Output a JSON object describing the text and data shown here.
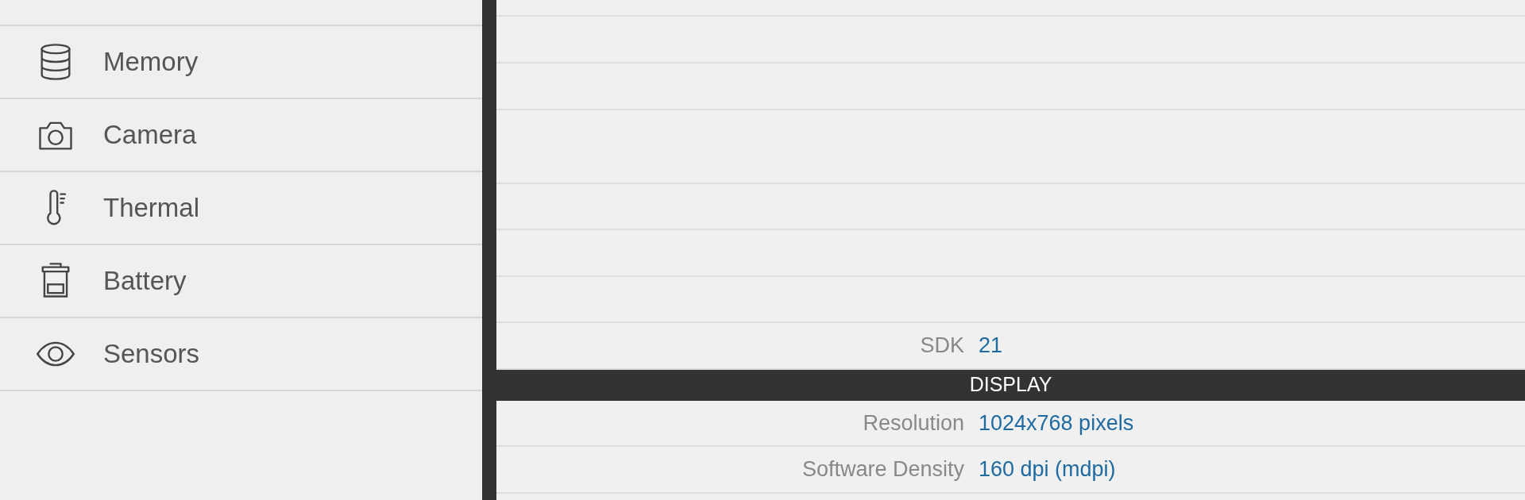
{
  "sidebar": {
    "items": [
      {
        "label": "Memory"
      },
      {
        "label": "Camera"
      },
      {
        "label": "Thermal"
      },
      {
        "label": "Battery"
      },
      {
        "label": "Sensors"
      }
    ]
  },
  "details": {
    "rows": [
      {
        "label": "SDK",
        "value": "21"
      }
    ]
  },
  "display_section": {
    "title": "DISPLAY",
    "rows": [
      {
        "label": "Resolution",
        "value": "1024x768 pixels"
      },
      {
        "label": "Software Density",
        "value": "160 dpi (mdpi)"
      }
    ]
  }
}
